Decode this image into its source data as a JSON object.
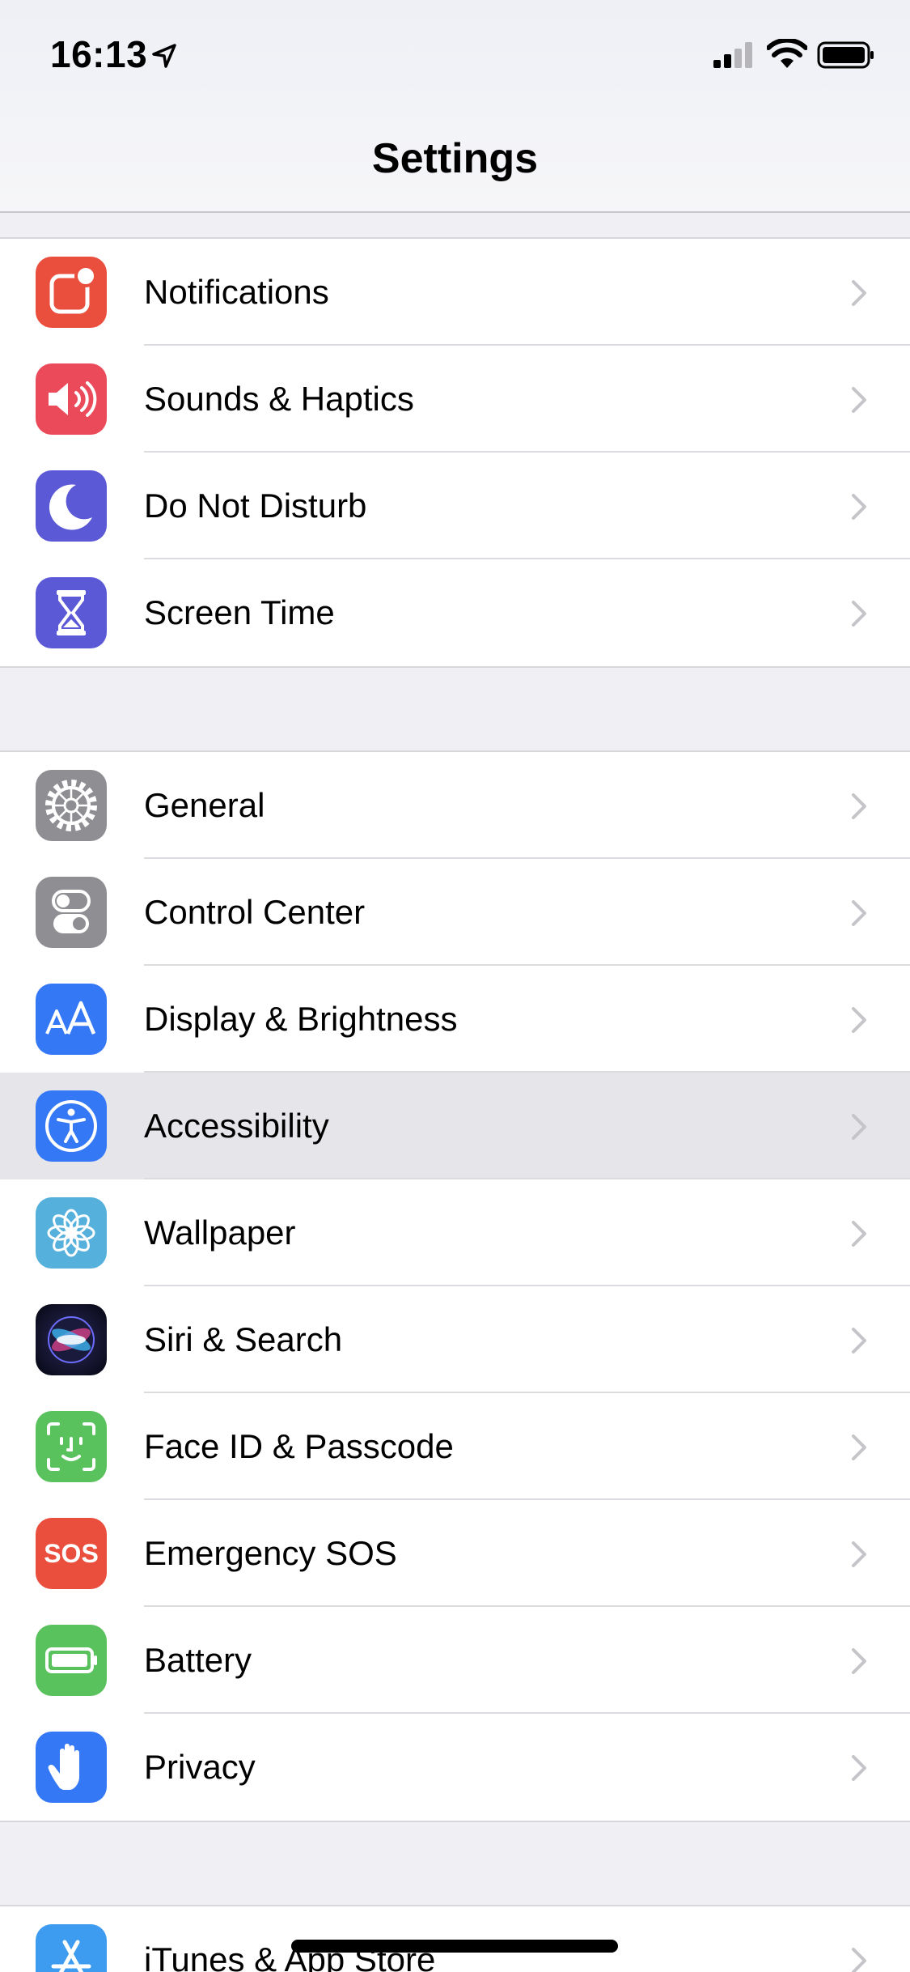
{
  "status_bar": {
    "time": "16:13"
  },
  "nav": {
    "title": "Settings"
  },
  "groups": [
    {
      "items": [
        {
          "label": "Notifications",
          "icon": "notifications-icon",
          "color": "#ea4e3d"
        },
        {
          "label": "Sounds & Haptics",
          "icon": "sounds-icon",
          "color": "#ea4a5a"
        },
        {
          "label": "Do Not Disturb",
          "icon": "moon-icon",
          "color": "#5b59d6"
        },
        {
          "label": "Screen Time",
          "icon": "hourglass-icon",
          "color": "#5b59d6"
        }
      ]
    },
    {
      "items": [
        {
          "label": "General",
          "icon": "gear-icon",
          "color": "#8e8e93"
        },
        {
          "label": "Control Center",
          "icon": "toggles-icon",
          "color": "#8e8e93"
        },
        {
          "label": "Display & Brightness",
          "icon": "text-size-icon",
          "color": "#3478f6"
        },
        {
          "label": "Accessibility",
          "icon": "accessibility-icon",
          "color": "#3478f6",
          "highlighted": true
        },
        {
          "label": "Wallpaper",
          "icon": "flower-icon",
          "color": "#55b0dc"
        },
        {
          "label": "Siri & Search",
          "icon": "siri-icon",
          "color": "#1c1c3a"
        },
        {
          "label": "Face ID & Passcode",
          "icon": "face-id-icon",
          "color": "#5ac25c"
        },
        {
          "label": "Emergency SOS",
          "icon": "sos-icon",
          "color": "#ea4e3d",
          "icon_text": "SOS"
        },
        {
          "label": "Battery",
          "icon": "battery-icon",
          "color": "#5ac25c"
        },
        {
          "label": "Privacy",
          "icon": "hand-icon",
          "color": "#3478f6"
        }
      ]
    },
    {
      "items": [
        {
          "label": "iTunes & App Store",
          "icon": "app-store-icon",
          "color": "#3d9cf0"
        }
      ]
    }
  ]
}
